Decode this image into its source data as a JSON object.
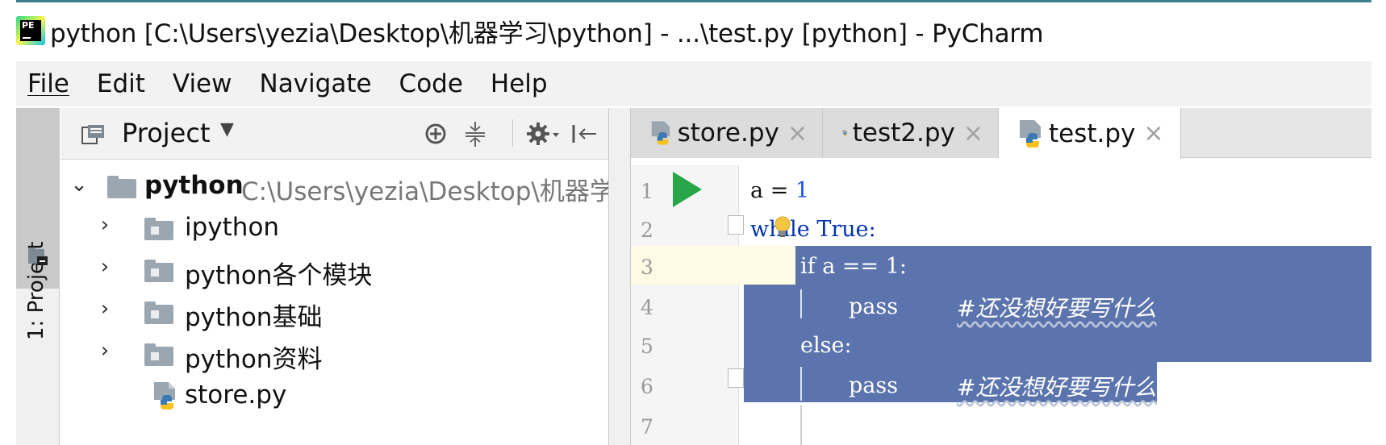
{
  "window": {
    "title": "python [C:\\Users\\yezia\\Desktop\\机器学习\\python] - ...\\test.py [python] - PyCharm",
    "accent_color": "#3e7e8c"
  },
  "menu": [
    "File",
    "Edit",
    "View",
    "Navigate",
    "Code",
    "Help"
  ],
  "tool_window": {
    "stripe_label": "1: Project"
  },
  "project_panel": {
    "title": "Project",
    "dropdown_icon": "caret-down-icon",
    "toolbar_icons": [
      "locate-icon",
      "collapse-all-icon",
      "settings-icon",
      "hide-panel-icon"
    ],
    "root": {
      "name": "python",
      "path": "C:\\Users\\yezia\\Desktop\\机器学习"
    },
    "items": [
      {
        "name": "ipython",
        "type": "folder"
      },
      {
        "name": "python各个模块",
        "type": "folder"
      },
      {
        "name": "python基础",
        "type": "folder"
      },
      {
        "name": "python资料",
        "type": "folder"
      },
      {
        "name": "store.py",
        "type": "python-file"
      }
    ]
  },
  "editor_tabs": [
    {
      "label": "store.py",
      "active": false
    },
    {
      "label": "test2.py",
      "active": false
    },
    {
      "label": "test.py",
      "active": true
    }
  ],
  "tab_close_glyph": "×",
  "editor": {
    "line_numbers": [
      "1",
      "2",
      "3",
      "4",
      "5",
      "6",
      "7"
    ],
    "lines": [
      {
        "a": "a",
        "b": " = ",
        "c": "1"
      },
      {
        "kw": "while",
        "rest": " True:"
      },
      {
        "text": "if a == 1:"
      },
      {
        "text": "pass",
        "comment": "#还没想好要写什么"
      },
      {
        "text": "else:"
      },
      {
        "text": "pass",
        "comment": "#还没想好要写什么"
      }
    ],
    "selection_color": "#5b74ad",
    "run_color": "#2aa64a"
  }
}
